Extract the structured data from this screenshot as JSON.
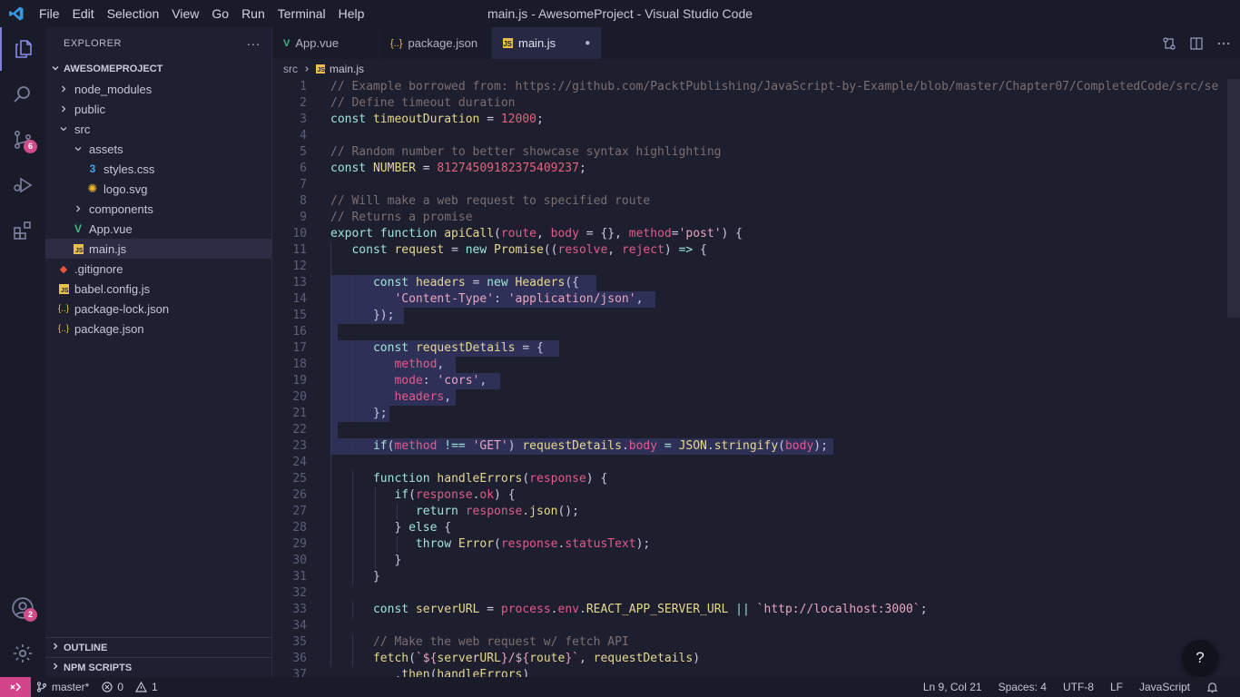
{
  "window": {
    "title": "main.js - AwesomeProject - Visual Studio Code"
  },
  "menu": [
    "File",
    "Edit",
    "Selection",
    "View",
    "Go",
    "Run",
    "Terminal",
    "Help"
  ],
  "activity": {
    "scm_badge": "6",
    "account_badge": "2"
  },
  "sidebar": {
    "title": "EXPLORER",
    "more": "···",
    "project": "AWESOMEPROJECT",
    "items": [
      {
        "label": "node_modules",
        "kind": "folder-closed"
      },
      {
        "label": "public",
        "kind": "folder-closed"
      },
      {
        "label": "src",
        "kind": "folder-open"
      },
      {
        "label": "assets",
        "kind": "folder-open"
      },
      {
        "label": "styles.css",
        "kind": "css-file-icon"
      },
      {
        "label": "logo.svg",
        "kind": "svg-file-icon"
      },
      {
        "label": "components",
        "kind": "folder-closed"
      },
      {
        "label": "App.vue",
        "kind": "vue-file-icon"
      },
      {
        "label": "main.js",
        "kind": "js-file-icon"
      },
      {
        "label": ".gitignore",
        "kind": "git-file-icon"
      },
      {
        "label": "babel.config.js",
        "kind": "js-file-icon"
      },
      {
        "label": "package-lock.json",
        "kind": "json-file-icon"
      },
      {
        "label": "package.json",
        "kind": "json-file-icon"
      }
    ],
    "outline": "OUTLINE",
    "npm": "NPM SCRIPTS"
  },
  "tabs": [
    {
      "label": "App.vue",
      "icon": "vue-file-icon"
    },
    {
      "label": "package.json",
      "icon": "json-file-icon"
    },
    {
      "label": "main.js",
      "icon": "js-file-icon",
      "dirty": "●"
    }
  ],
  "breadcrumb": {
    "folder": "src",
    "file": "main.js"
  },
  "help": "?",
  "status": {
    "branch": "master*",
    "errors": "0",
    "warnings": "1",
    "position": "Ln 9, Col 21",
    "spaces": "Spaces: 4",
    "encoding": "UTF-8",
    "eol": "LF",
    "language": "JavaScript"
  },
  "editor": {
    "lines": [
      [
        [
          "c-com",
          "// Example borrowed from: https://github.com/PacktPublishing/JavaScript-by-Example/blob/master/Chapter07/CompletedCode/src/se"
        ]
      ],
      [
        [
          "c-com",
          "// Define timeout duration"
        ]
      ],
      [
        [
          "c-kw",
          "const "
        ],
        [
          "c-var",
          "timeoutDuration"
        ],
        [
          "c-pun",
          " = "
        ],
        [
          "c-num",
          "12000"
        ],
        [
          "c-pun",
          ";"
        ]
      ],
      [],
      [
        [
          "c-com",
          "// Random number to better showcase syntax highlighting"
        ]
      ],
      [
        [
          "c-kw",
          "const "
        ],
        [
          "c-var",
          "NUMBER"
        ],
        [
          "c-pun",
          " = "
        ],
        [
          "c-num",
          "81274509182375409237"
        ],
        [
          "c-pun",
          ";"
        ]
      ],
      [],
      [
        [
          "c-com",
          "// Will make a web request to specified route"
        ]
      ],
      [
        [
          "c-com",
          "// Returns a promise"
        ]
      ],
      [
        [
          "c-kw",
          "export function "
        ],
        [
          "c-fn",
          "apiCall"
        ],
        [
          "c-pun",
          "("
        ],
        [
          "c-param",
          "route"
        ],
        [
          "c-pun",
          ", "
        ],
        [
          "c-param",
          "body"
        ],
        [
          "c-pun",
          " = {}, "
        ],
        [
          "c-param",
          "method"
        ],
        [
          "c-pun",
          "="
        ],
        [
          "c-str",
          "'post'"
        ],
        [
          "c-pun",
          ") {"
        ]
      ],
      [
        [
          "c-pun",
          "   "
        ],
        [
          "c-kw",
          "const "
        ],
        [
          "c-var",
          "request"
        ],
        [
          "c-pun",
          " = "
        ],
        [
          "c-kw",
          "new "
        ],
        [
          "c-fn",
          "Promise"
        ],
        [
          "c-pun",
          "(("
        ],
        [
          "c-param",
          "resolve"
        ],
        [
          "c-pun",
          ", "
        ],
        [
          "c-param",
          "reject"
        ],
        [
          "c-pun",
          ") "
        ],
        [
          "c-kw",
          "=>"
        ],
        [
          "c-pun",
          " {"
        ]
      ],
      [],
      [
        [
          "c-pun",
          "      "
        ],
        [
          "c-kw",
          "const "
        ],
        [
          "c-var",
          "headers"
        ],
        [
          "c-pun",
          " = "
        ],
        [
          "c-kw",
          "new "
        ],
        [
          "c-fn",
          "Headers"
        ],
        [
          "c-pun",
          "({"
        ]
      ],
      [
        [
          "c-pun",
          "         "
        ],
        [
          "c-str",
          "'Content-Type'"
        ],
        [
          "c-pun",
          ": "
        ],
        [
          "c-str",
          "'application/json'"
        ],
        [
          "c-pun",
          ","
        ]
      ],
      [
        [
          "c-pun",
          "      });"
        ]
      ],
      [],
      [
        [
          "c-pun",
          "      "
        ],
        [
          "c-kw",
          "const "
        ],
        [
          "c-var",
          "requestDetails"
        ],
        [
          "c-pun",
          " = {"
        ]
      ],
      [
        [
          "c-pun",
          "         "
        ],
        [
          "c-param",
          "method"
        ],
        [
          "c-pun",
          ","
        ]
      ],
      [
        [
          "c-pun",
          "         "
        ],
        [
          "c-param",
          "mode"
        ],
        [
          "c-pun",
          ": "
        ],
        [
          "c-str",
          "'cors'"
        ],
        [
          "c-pun",
          ","
        ]
      ],
      [
        [
          "c-pun",
          "         "
        ],
        [
          "c-param",
          "headers"
        ],
        [
          "c-pun",
          ","
        ]
      ],
      [
        [
          "c-pun",
          "      };"
        ]
      ],
      [],
      [
        [
          "c-pun",
          "      "
        ],
        [
          "c-kw",
          "if"
        ],
        [
          "c-pun",
          "("
        ],
        [
          "c-param",
          "method"
        ],
        [
          "c-kw",
          " !== "
        ],
        [
          "c-str",
          "'GET'"
        ],
        [
          "c-pun",
          ") "
        ],
        [
          "c-var",
          "requestDetails"
        ],
        [
          "c-pun",
          "."
        ],
        [
          "c-param",
          "body"
        ],
        [
          "c-kw",
          " = "
        ],
        [
          "c-var",
          "JSON"
        ],
        [
          "c-pun",
          "."
        ],
        [
          "c-fn",
          "stringify"
        ],
        [
          "c-pun",
          "("
        ],
        [
          "c-param",
          "body"
        ],
        [
          "c-pun",
          ");"
        ]
      ],
      [],
      [
        [
          "c-pun",
          "      "
        ],
        [
          "c-kw",
          "function "
        ],
        [
          "c-fn",
          "handleErrors"
        ],
        [
          "c-pun",
          "("
        ],
        [
          "c-param",
          "response"
        ],
        [
          "c-pun",
          ") {"
        ]
      ],
      [
        [
          "c-pun",
          "         "
        ],
        [
          "c-kw",
          "if"
        ],
        [
          "c-pun",
          "("
        ],
        [
          "c-param",
          "response"
        ],
        [
          "c-pun",
          "."
        ],
        [
          "c-param",
          "ok"
        ],
        [
          "c-pun",
          ") {"
        ]
      ],
      [
        [
          "c-pun",
          "            "
        ],
        [
          "c-kw",
          "return "
        ],
        [
          "c-param",
          "response"
        ],
        [
          "c-pun",
          "."
        ],
        [
          "c-fn",
          "json"
        ],
        [
          "c-pun",
          "();"
        ]
      ],
      [
        [
          "c-pun",
          "         } "
        ],
        [
          "c-kw",
          "else"
        ],
        [
          "c-pun",
          " {"
        ]
      ],
      [
        [
          "c-pun",
          "            "
        ],
        [
          "c-kw",
          "throw "
        ],
        [
          "c-fn",
          "Error"
        ],
        [
          "c-pun",
          "("
        ],
        [
          "c-param",
          "response"
        ],
        [
          "c-pun",
          "."
        ],
        [
          "c-param",
          "statusText"
        ],
        [
          "c-pun",
          ");"
        ]
      ],
      [
        [
          "c-pun",
          "         }"
        ]
      ],
      [
        [
          "c-pun",
          "      }"
        ]
      ],
      [],
      [
        [
          "c-pun",
          "      "
        ],
        [
          "c-kw",
          "const "
        ],
        [
          "c-var",
          "serverURL"
        ],
        [
          "c-pun",
          " = "
        ],
        [
          "c-param",
          "process"
        ],
        [
          "c-pun",
          "."
        ],
        [
          "c-param",
          "env"
        ],
        [
          "c-pun",
          "."
        ],
        [
          "c-var",
          "REACT_APP_SERVER_URL"
        ],
        [
          "c-kw",
          " || "
        ],
        [
          "c-str",
          "`http://localhost:3000`"
        ],
        [
          "c-pun",
          ";"
        ]
      ],
      [],
      [
        [
          "c-pun",
          "      "
        ],
        [
          "c-com",
          "// Make the web request w/ fetch API"
        ]
      ],
      [
        [
          "c-pun",
          "      "
        ],
        [
          "c-fn",
          "fetch"
        ],
        [
          "c-pun",
          "("
        ],
        [
          "c-str",
          "`${"
        ],
        [
          "c-var",
          "serverURL"
        ],
        [
          "c-str",
          "}/${"
        ],
        [
          "c-var",
          "route"
        ],
        [
          "c-str",
          "}`"
        ],
        [
          "c-pun",
          ", "
        ],
        [
          "c-var",
          "requestDetails"
        ],
        [
          "c-pun",
          ")"
        ]
      ],
      [
        [
          "c-pun",
          "         ."
        ],
        [
          "c-fn",
          "then"
        ],
        [
          "c-pun",
          "("
        ],
        [
          "c-var",
          "handleErrors"
        ],
        [
          "c-pun",
          ")"
        ]
      ]
    ]
  }
}
